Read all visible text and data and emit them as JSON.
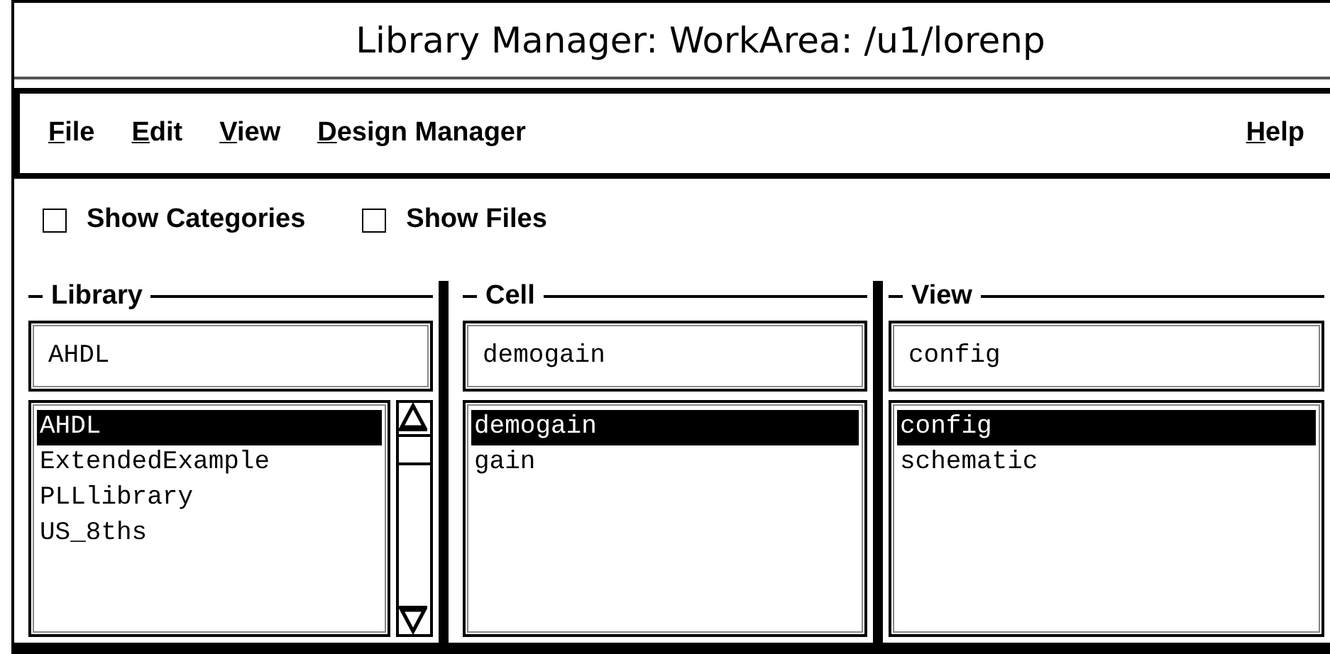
{
  "window": {
    "title": "Library Manager: WorkArea: /u1/lorenp"
  },
  "menu": [
    {
      "label": "File"
    },
    {
      "label": "Edit"
    },
    {
      "label": "View"
    },
    {
      "label": "Design Manager"
    },
    {
      "label": "Help",
      "kind": "right"
    }
  ],
  "options": [
    {
      "label": "Show Categories",
      "checked": false
    },
    {
      "label": "Show Files",
      "checked": false
    }
  ],
  "panels": [
    {
      "label": "Library",
      "value": "AHDL",
      "scrollbar": true,
      "items": [
        {
          "label": "AHDL",
          "selected": true
        },
        {
          "label": "ExtendedExample",
          "selected": false
        },
        {
          "label": "PLLlibrary",
          "selected": false
        },
        {
          "label": "US_8ths",
          "selected": false
        }
      ]
    },
    {
      "label": "Cell",
      "value": "demogain",
      "scrollbar": false,
      "items": [
        {
          "label": "demogain",
          "selected": true
        },
        {
          "label": "gain",
          "selected": false
        }
      ]
    },
    {
      "label": "View",
      "value": "config",
      "scrollbar": false,
      "items": [
        {
          "label": "config",
          "selected": true
        },
        {
          "label": "schematic",
          "selected": false
        }
      ]
    }
  ]
}
